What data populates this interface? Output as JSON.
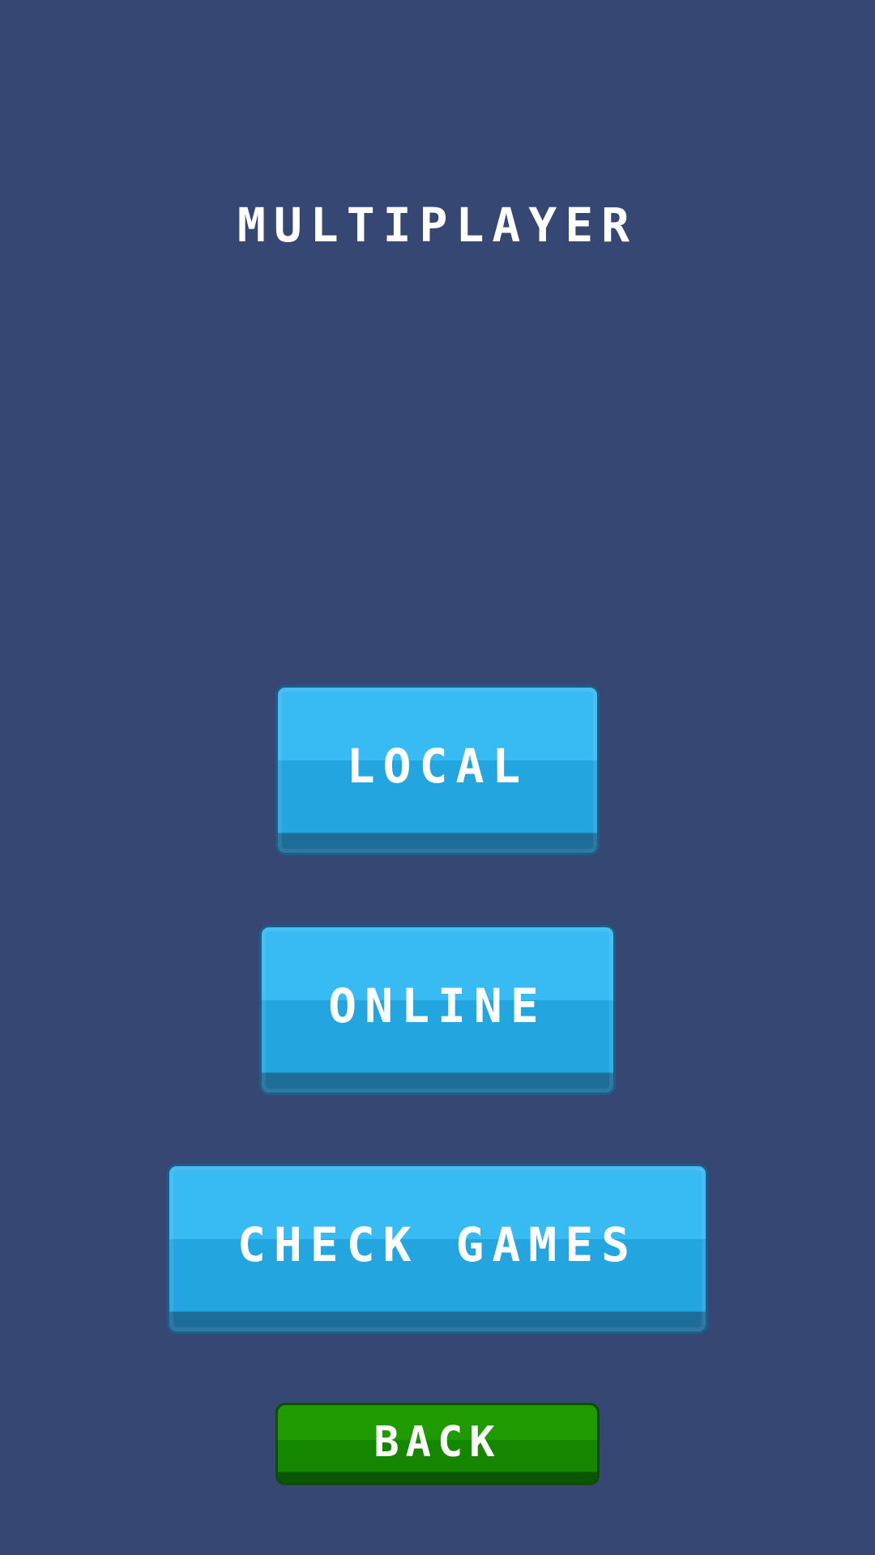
{
  "screen": {
    "title": "MULTIPLAYER",
    "background_color": "#374774"
  },
  "buttons": {
    "local": "LOCAL",
    "online": "ONLINE",
    "check_games": "CHECK GAMES",
    "back": "BACK"
  },
  "colors": {
    "primary_button": "#38baf3",
    "back_button": "#1f9a00"
  }
}
